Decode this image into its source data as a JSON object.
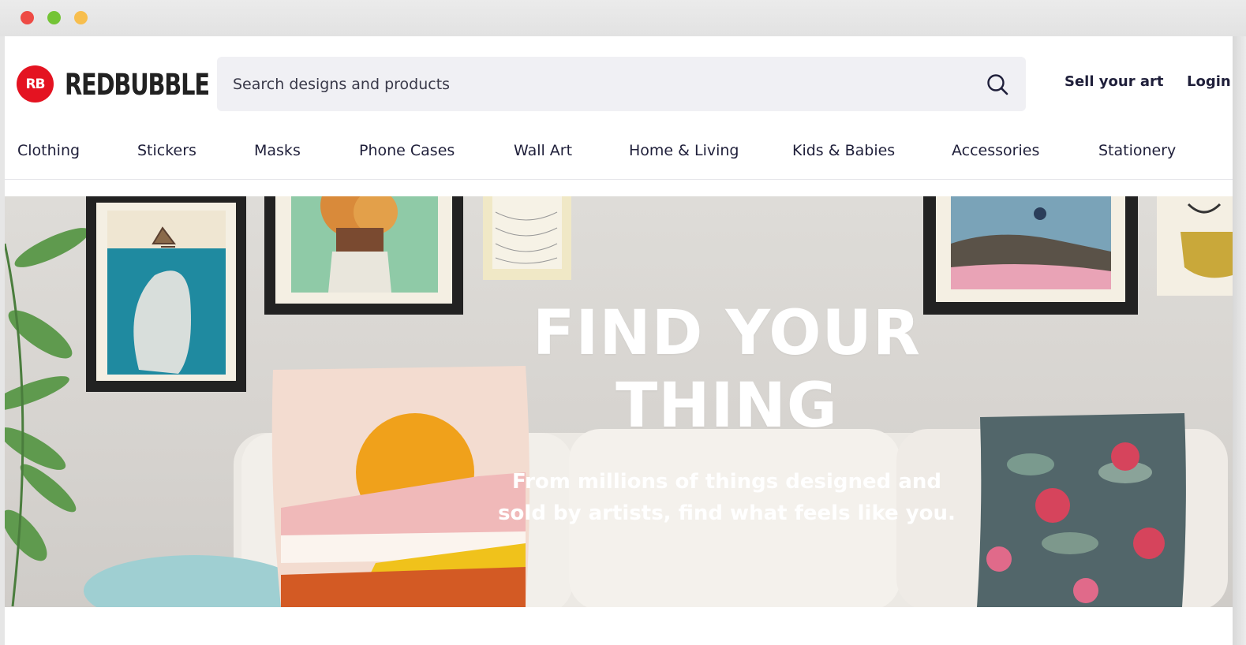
{
  "brand": {
    "logo_mark": "RB",
    "name": "REDBUBBLE",
    "color": "#e41321"
  },
  "search": {
    "placeholder": "Search designs and products"
  },
  "header_links": {
    "sell": "Sell your art",
    "login": "Login"
  },
  "nav": {
    "items": [
      "Clothing",
      "Stickers",
      "Masks",
      "Phone Cases",
      "Wall Art",
      "Home & Living",
      "Kids & Babies",
      "Accessories",
      "Stationery"
    ]
  },
  "hero": {
    "title_line1": "FIND YOUR",
    "title_line2": "THING",
    "subtitle_line1": "From millions of things designed and",
    "subtitle_line2": "sold by artists, find what feels like you."
  },
  "icons": {
    "search": "search-icon"
  }
}
